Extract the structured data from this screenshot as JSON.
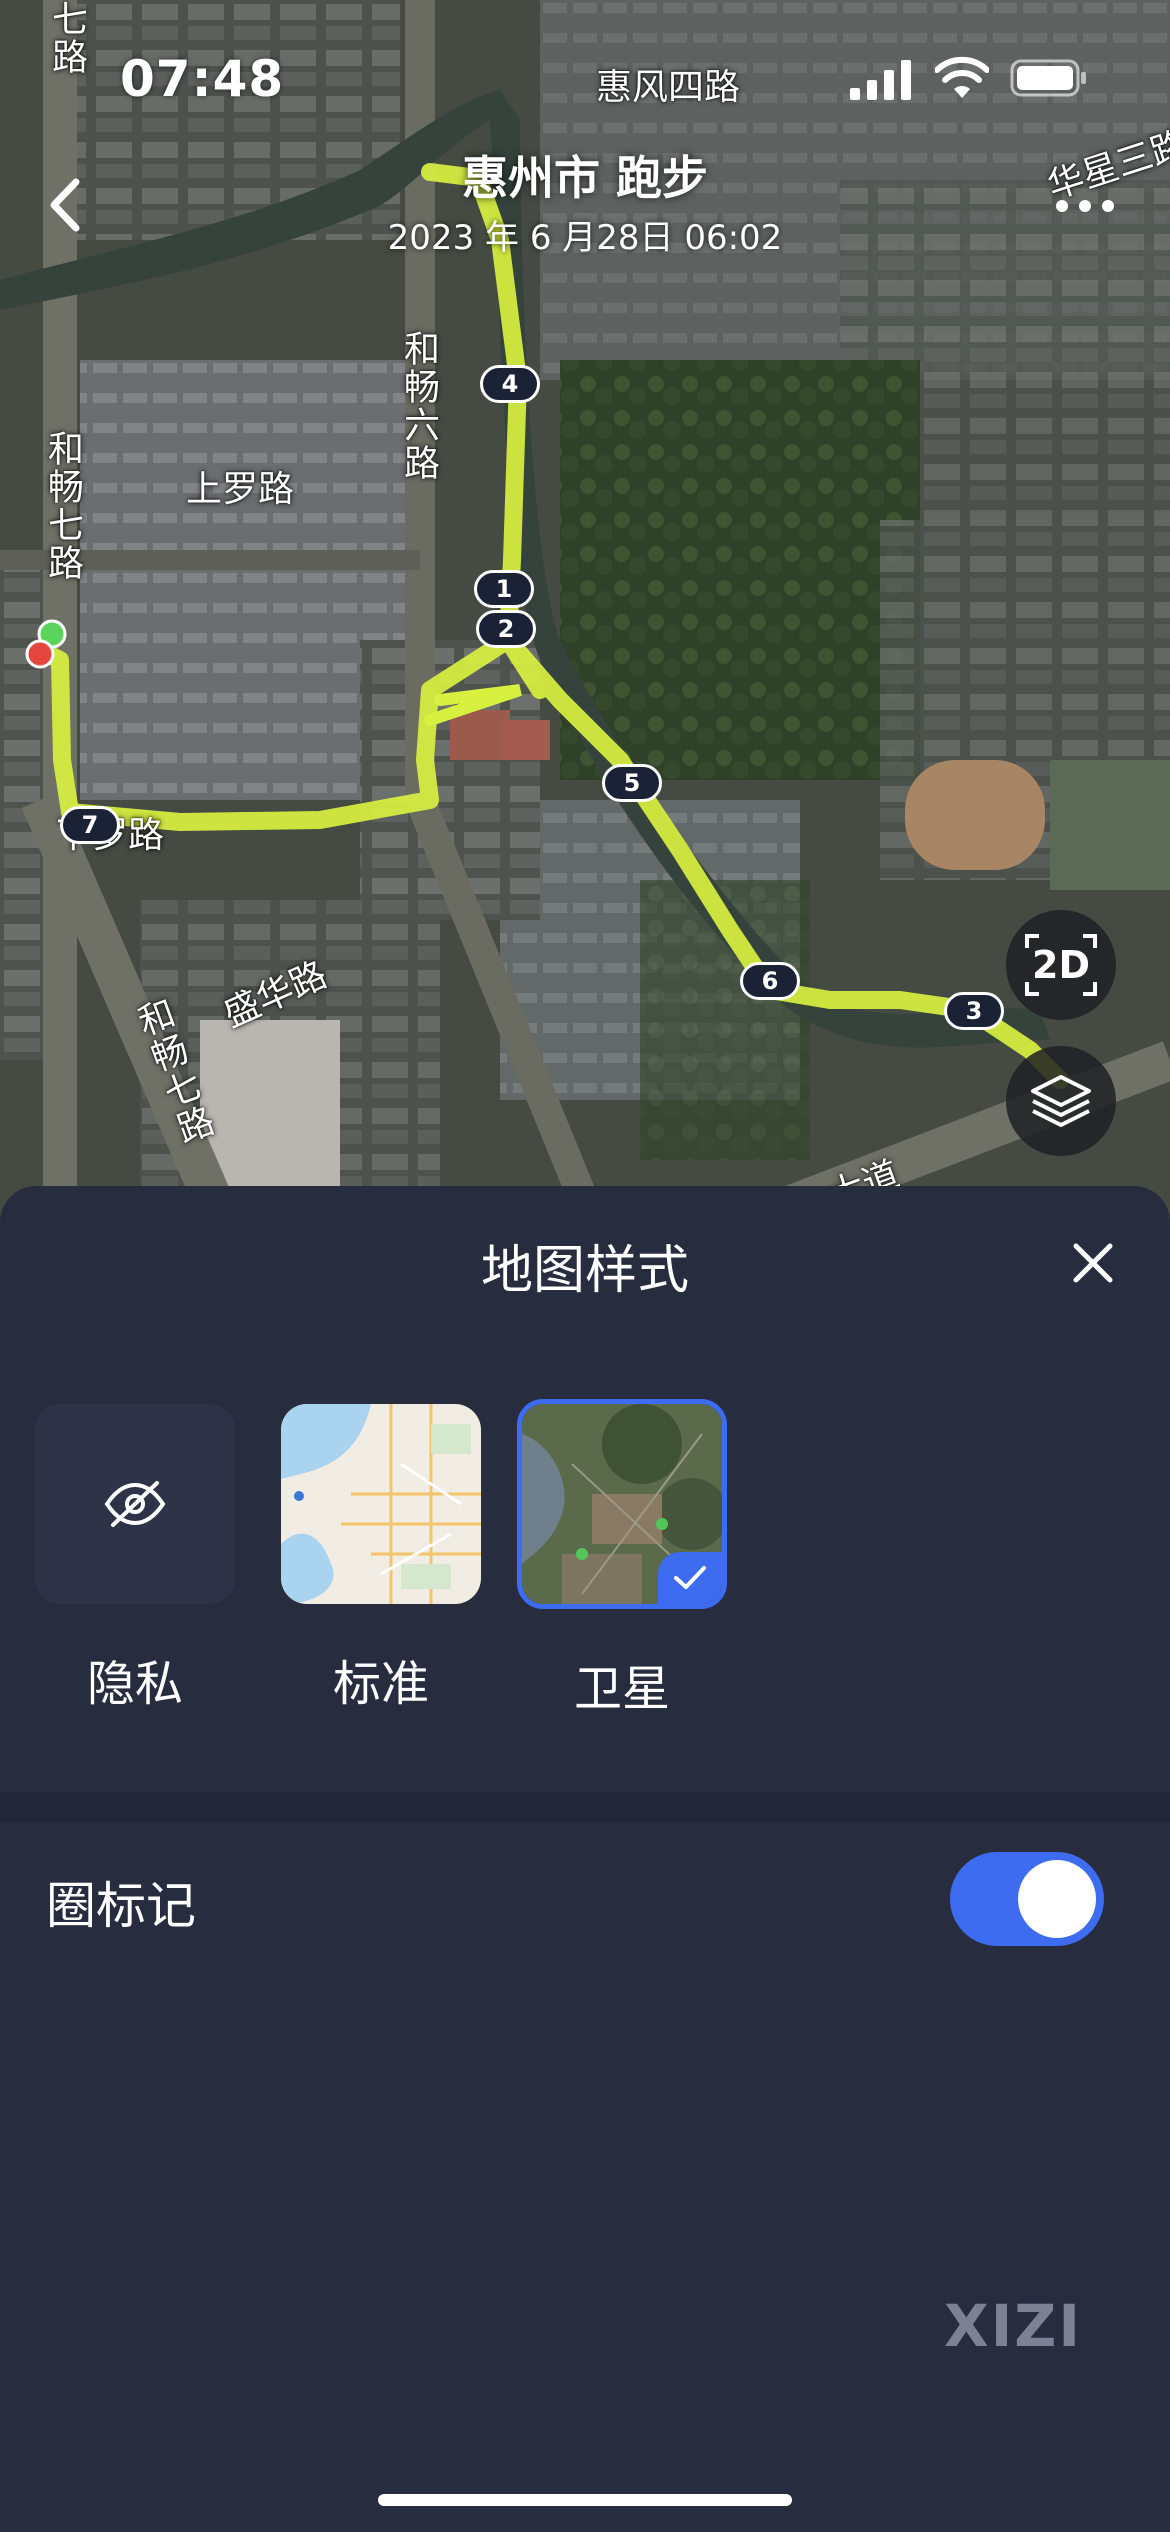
{
  "status_bar": {
    "time": "07:48"
  },
  "header": {
    "title": "惠州市 跑步",
    "datetime": "2023 年 6 月28日 06:02",
    "back_icon": "chevron-left-icon",
    "more_icon": "more-dots-icon"
  },
  "map": {
    "road_labels": {
      "hefeng4": "惠风四路",
      "huaxing3": "华星三路",
      "hechang7_top": "和畅七路",
      "hechang7_top_fragment": "七路",
      "hechang6": "和畅六路",
      "shangluo": "上罗路",
      "xialuo": "下罗路",
      "shenghua": "盛华路",
      "hechang7_bottom": "和畅七路",
      "avenue_fragment": "大道"
    },
    "lap_markers": [
      "4",
      "1",
      "2",
      "5",
      "7",
      "6",
      "3"
    ],
    "route_color": "#d8f040",
    "mode_button": "2D",
    "layers_icon": "layers-icon"
  },
  "sheet": {
    "title": "地图样式",
    "close_icon": "close-icon",
    "styles": [
      {
        "label": "隐私",
        "icon": "eye-off-icon",
        "selected": false
      },
      {
        "label": "标准",
        "selected": false
      },
      {
        "label": "卫星",
        "selected": true
      }
    ],
    "lap_marks_label": "圈标记",
    "lap_marks_enabled": true,
    "accent_color": "#3d6cf0"
  },
  "watermark": "XIZI"
}
